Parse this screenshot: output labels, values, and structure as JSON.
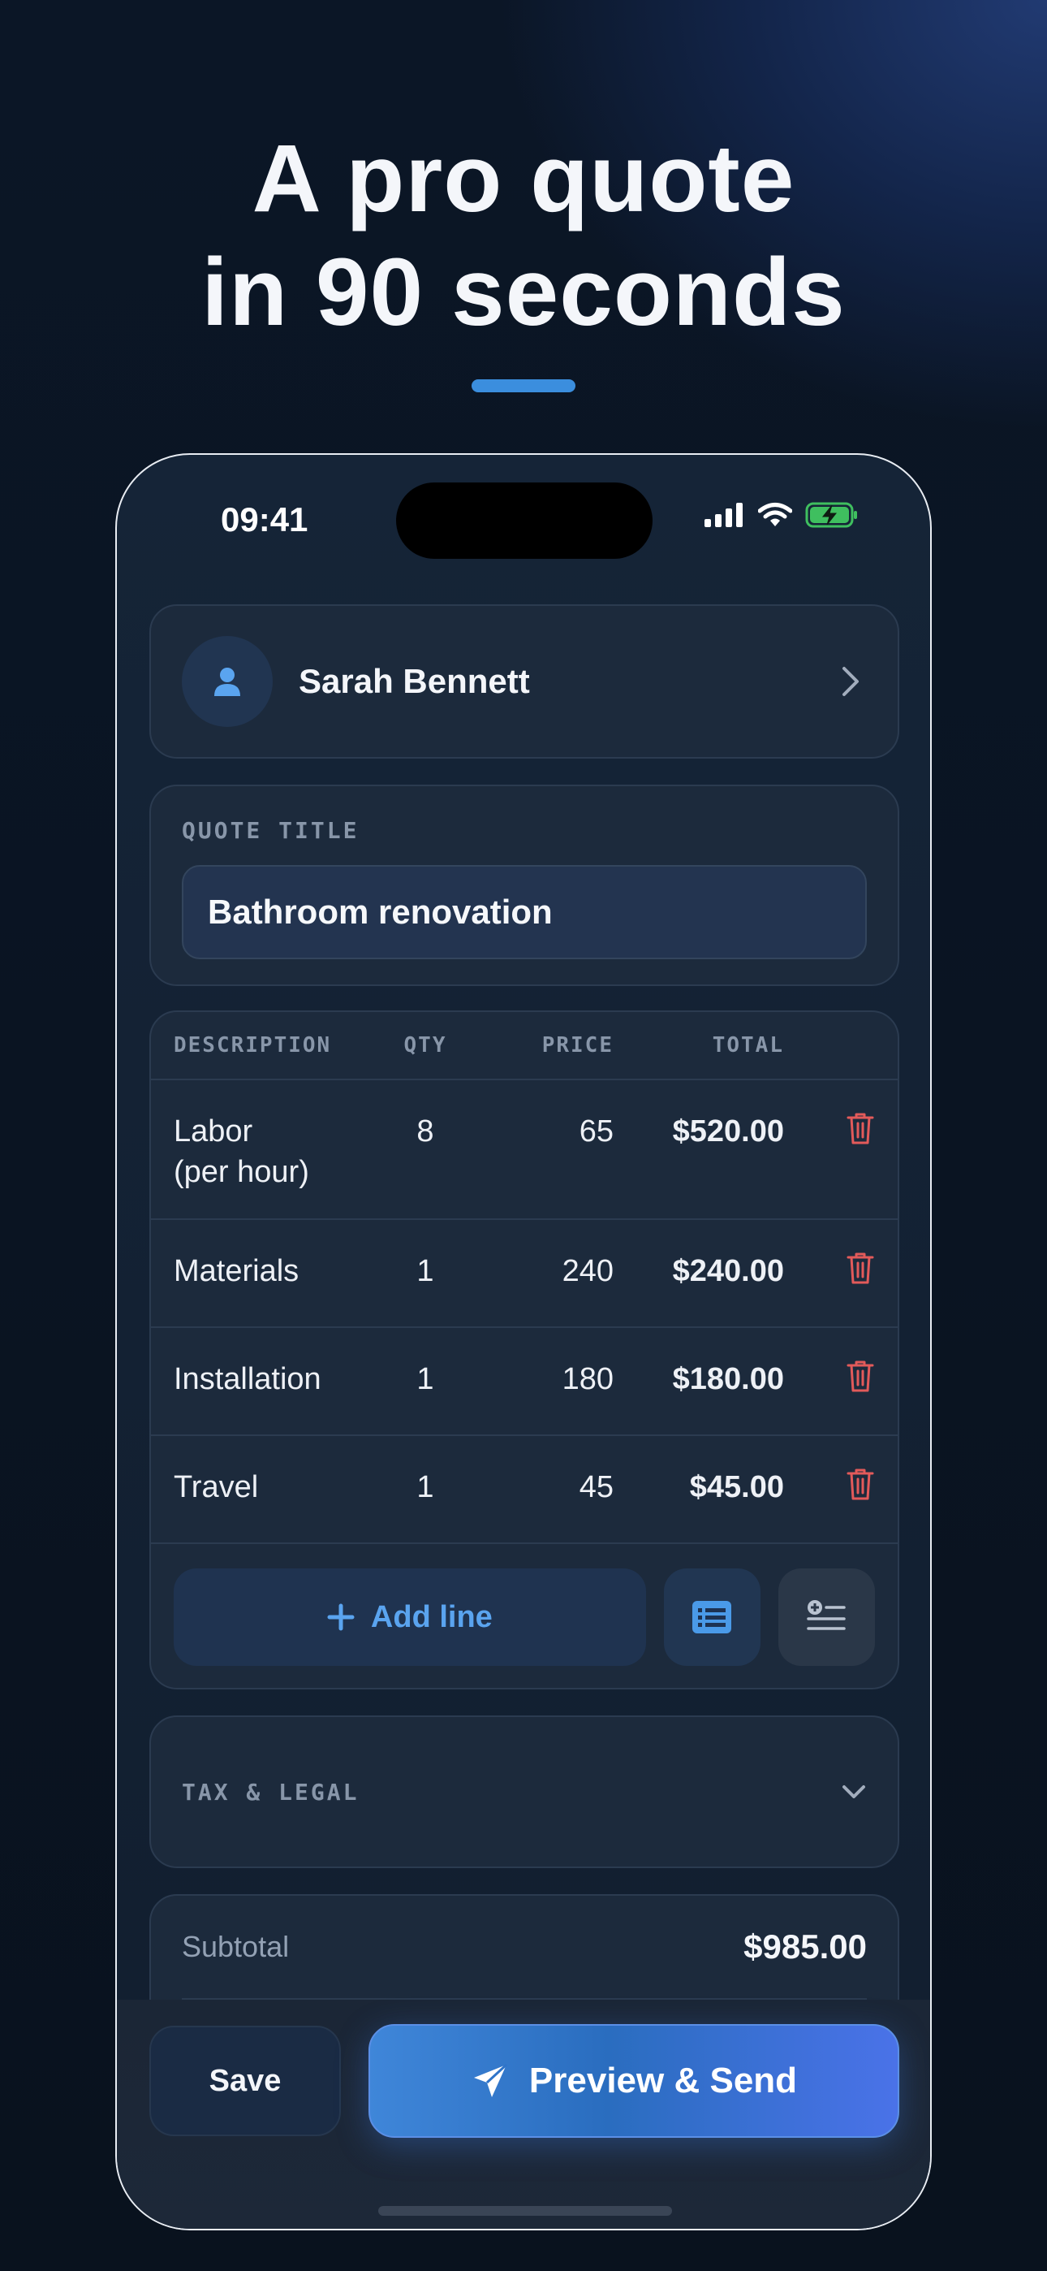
{
  "headline": {
    "line1": "A pro quote",
    "line2": "in 90 seconds"
  },
  "colors": {
    "accent": "#3b8ede",
    "danger": "#e25a5a",
    "link": "#5aa4ef",
    "primary_gradient": [
      "#3f86d9",
      "#4a72e8"
    ]
  },
  "status_bar": {
    "time": "09:41",
    "icons": [
      "signal-icon",
      "wifi-icon",
      "battery-charging-icon"
    ]
  },
  "client": {
    "name": "Sarah Bennett",
    "icon": "person-icon"
  },
  "quote": {
    "title_label": "QUOTE TITLE",
    "title_value": "Bathroom renovation"
  },
  "line_items": {
    "headers": {
      "description": "DESCRIPTION",
      "qty": "QTY",
      "price": "PRICE",
      "total": "TOTAL"
    },
    "rows": [
      {
        "description_line1": "Labor",
        "description_line2": "(per hour)",
        "qty": "8",
        "price": "65",
        "total": "$520.00"
      },
      {
        "description_line1": "Materials",
        "description_line2": "",
        "qty": "1",
        "price": "240",
        "total": "$240.00"
      },
      {
        "description_line1": "Installation",
        "description_line2": "",
        "qty": "1",
        "price": "180",
        "total": "$180.00"
      },
      {
        "description_line1": "Travel",
        "description_line2": "",
        "qty": "1",
        "price": "45",
        "total": "$45.00"
      }
    ],
    "add_line_label": "Add line"
  },
  "tax_section": {
    "label": "TAX & LEGAL"
  },
  "totals": {
    "subtotal_label": "Subtotal",
    "subtotal_value": "$985.00"
  },
  "footer": {
    "save_label": "Save",
    "send_label": "Preview & Send"
  }
}
